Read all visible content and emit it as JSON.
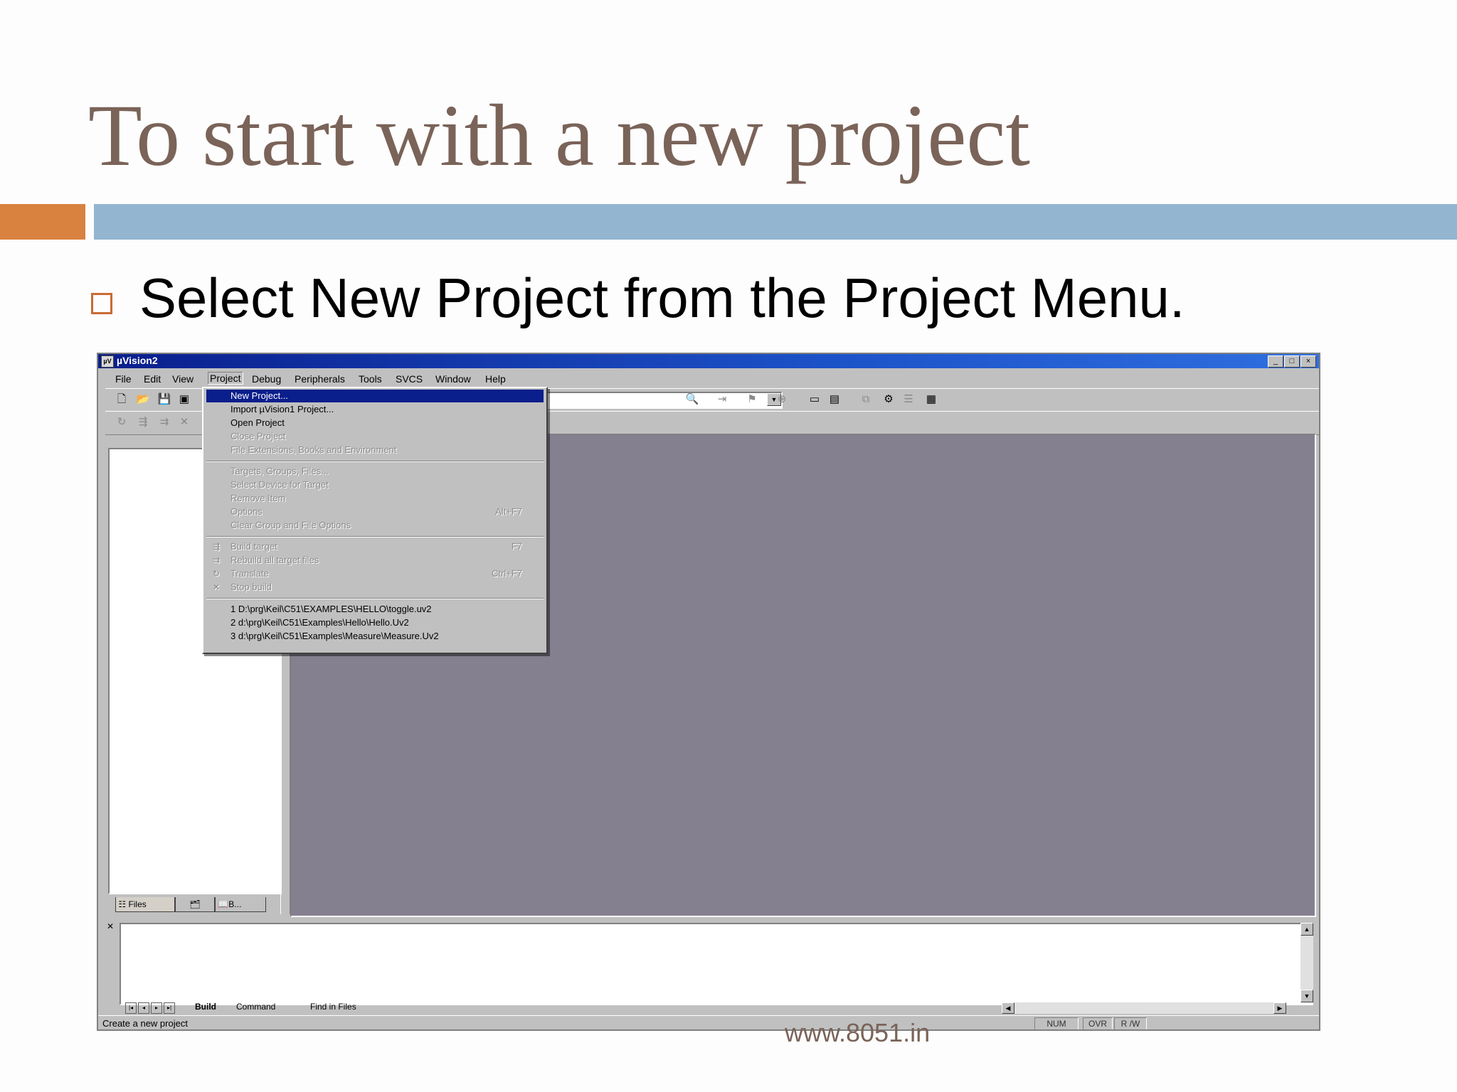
{
  "slide": {
    "title": "To start with a new project",
    "bullet": "Select New Project from the Project Menu.",
    "footer": "www.8051.in"
  },
  "colors": {
    "title": "#7a6358",
    "accent_orange": "#d9813f",
    "accent_blue": "#93b5d0",
    "titlebar": "#0a1e8c",
    "mdi_background": "#858090"
  },
  "window": {
    "title": "µVision2",
    "app_icon": "µV",
    "controls": [
      "_",
      "□",
      "×"
    ]
  },
  "menubar": [
    "File",
    "Edit",
    "View",
    "Project",
    "Debug",
    "Peripherals",
    "Tools",
    "SVCS",
    "Window",
    "Help"
  ],
  "toolbar": {
    "icons": [
      "new-file-icon",
      "open-folder-icon",
      "save-icon",
      "save-all-icon",
      "find-icon",
      "build-icon",
      "debug-icon",
      "window-icon",
      "options-icon"
    ]
  },
  "project_menu": {
    "group1": [
      {
        "label": "New Project...",
        "state": "selected"
      },
      {
        "label": "Import µVision1 Project...",
        "state": "enabled"
      },
      {
        "label": "Open Project",
        "state": "enabled"
      },
      {
        "label": "Close Project",
        "state": "disabled"
      },
      {
        "label": "File Extensions, Books and Environment",
        "state": "disabled"
      }
    ],
    "group2": [
      {
        "label": "Targets, Groups, Files...",
        "shortcut": ""
      },
      {
        "label": "Select Device for Target",
        "shortcut": ""
      },
      {
        "label": "Remove Item",
        "shortcut": ""
      },
      {
        "label": "Options",
        "shortcut": "Alt+F7"
      },
      {
        "label": "Clear Group and File Options",
        "shortcut": ""
      }
    ],
    "group3": [
      {
        "label": "Build target",
        "shortcut": "F7",
        "icon": "build-target-icon"
      },
      {
        "label": "Rebuild all target files",
        "shortcut": "",
        "icon": "rebuild-icon"
      },
      {
        "label": "Translate",
        "shortcut": "Ctrl+F7",
        "icon": "translate-icon"
      },
      {
        "label": "Stop build",
        "shortcut": "",
        "icon": "stop-build-icon"
      }
    ],
    "recent": [
      "1 D:\\prg\\Keil\\C51\\EXAMPLES\\HELLO\\toggle.uv2",
      "2 d:\\prg\\Keil\\C51\\Examples\\Hello\\Hello.Uv2",
      "3 d:\\prg\\Keil\\C51\\Examples\\Measure\\Measure.Uv2"
    ]
  },
  "project_panel": {
    "tabs": [
      "Files",
      "",
      "B..."
    ]
  },
  "output": {
    "tabs": [
      "Build",
      "Command",
      "Find in Files"
    ]
  },
  "statusbar": {
    "text": "Create a new project",
    "indicators": [
      "NUM",
      "OVR",
      "R /W"
    ]
  }
}
